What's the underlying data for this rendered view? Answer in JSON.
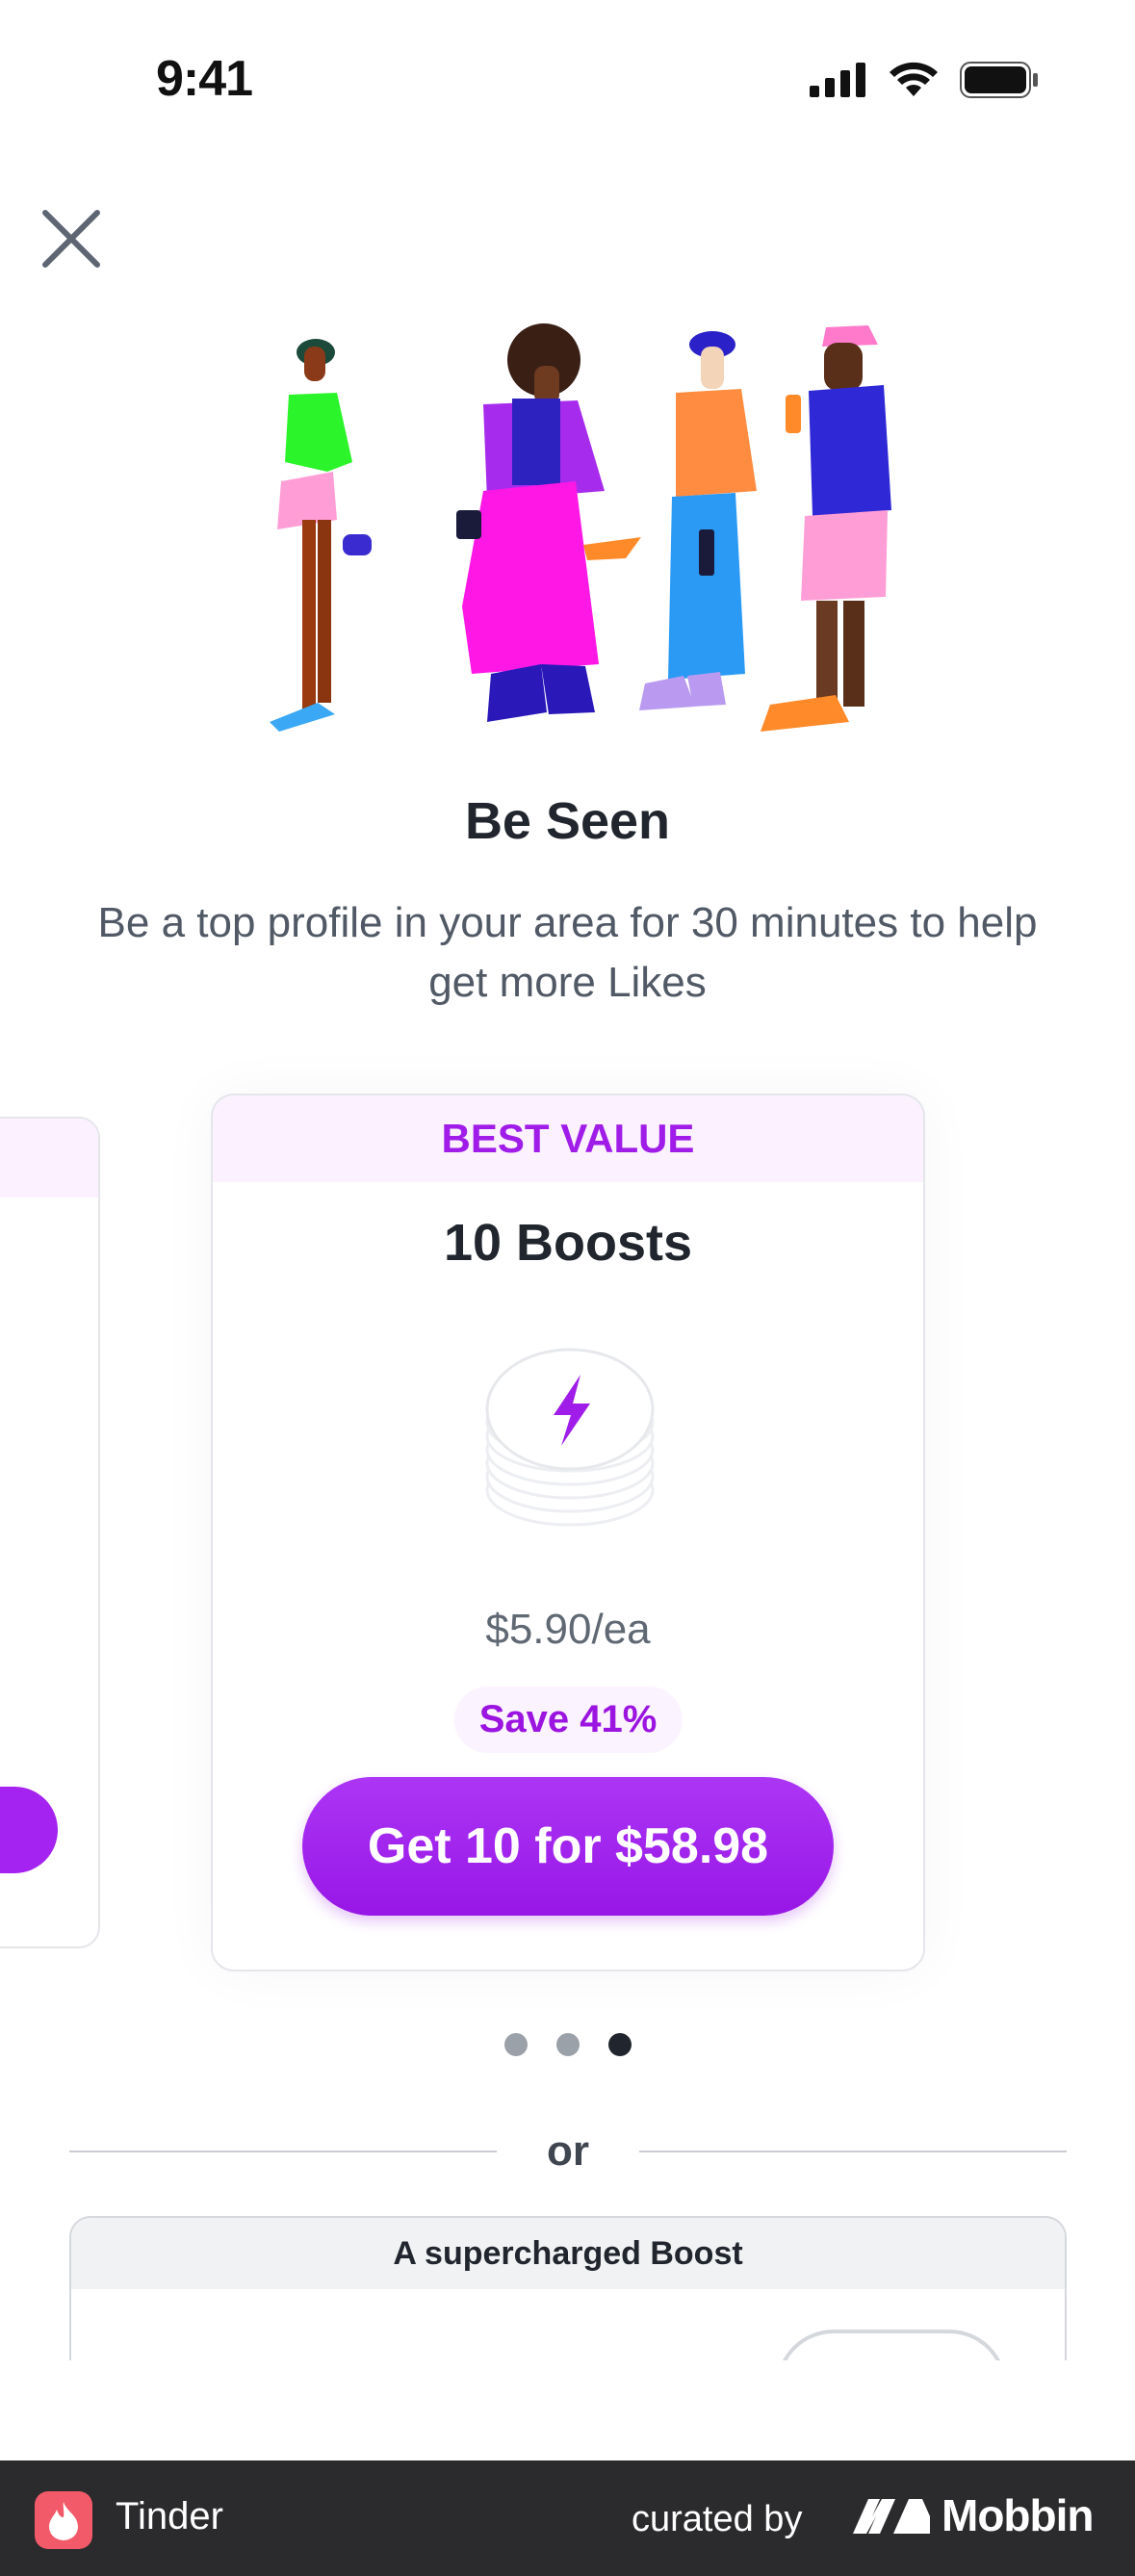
{
  "status_bar": {
    "time": "9:41"
  },
  "header": {
    "close_label": "×"
  },
  "hero": {
    "title": "Be Seen",
    "subtitle": "Be a top profile in your area for 30 minutes to help get more Likes"
  },
  "carousel": {
    "current_card": {
      "badge": "BEST VALUE",
      "title": "10 Boosts",
      "price_each": "$5.90/ea",
      "save": "Save 41%",
      "cta": "Get 10 for $58.98"
    },
    "page_count": 3,
    "active_page": 3
  },
  "divider": {
    "text": "or"
  },
  "super_boost": {
    "header": "A supercharged Boost"
  },
  "footer": {
    "app_name": "Tinder",
    "curated_by": "curated by",
    "brand": "Mobbin"
  },
  "colors": {
    "accent": "#a01ce8",
    "button": "#9816e6",
    "footer_bg": "#2b2b2d",
    "tinder": "#f25a6a"
  },
  "icons": [
    "signal-icon",
    "wifi-icon",
    "battery-icon",
    "close-icon",
    "boost-stack-icon",
    "lightning-icon",
    "tinder-logo-icon",
    "mobbin-logo-icon"
  ]
}
